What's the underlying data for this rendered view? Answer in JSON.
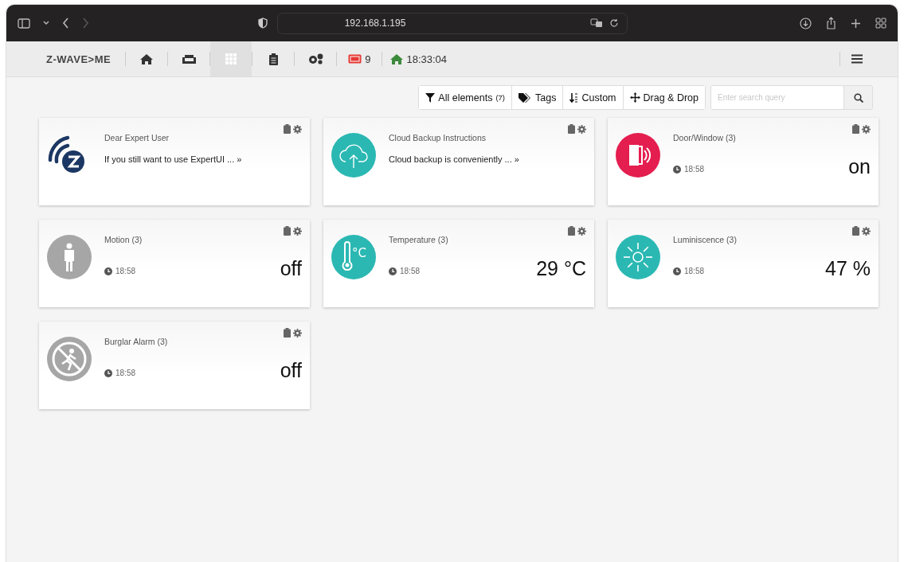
{
  "browser": {
    "url": "192.168.1.195"
  },
  "app_bar": {
    "logo": "Z-WAVE>ME",
    "nav": [
      {
        "selected": false
      },
      {
        "selected": false
      },
      {
        "selected": true
      },
      {
        "selected": false
      },
      {
        "selected": false
      }
    ],
    "events_count": "9",
    "time": "18:33:04"
  },
  "toolbar": {
    "filters": [
      {
        "label": "All elements",
        "count": "(7)"
      },
      {
        "label": "Tags"
      },
      {
        "label": "Custom"
      },
      {
        "label": "Drag & Drop"
      }
    ],
    "search": {
      "placeholder": "Enter search query"
    }
  },
  "cards": [
    {
      "kind": "message",
      "title": "Dear Expert User",
      "text": "If you still want to use ExpertUI ... »"
    },
    {
      "kind": "message",
      "title": "Cloud Backup Instructions",
      "text": "Cloud backup is conveniently ... »",
      "color": "#2bb8b3"
    },
    {
      "kind": "sensor",
      "title": "Door/Window (3)",
      "time": "18:58",
      "value": "on",
      "color": "#e41e4f"
    },
    {
      "kind": "sensor",
      "title": "Motion (3)",
      "time": "18:58",
      "value": "off",
      "color": "#a6a6a6"
    },
    {
      "kind": "sensor",
      "title": "Temperature (3)",
      "icon_label": "°C",
      "time": "18:58",
      "value": "29 °C",
      "color": "#2bb8b3"
    },
    {
      "kind": "sensor",
      "title": "Luminiscence (3)",
      "time": "18:58",
      "value": "47 %",
      "color": "#2bb8b3"
    },
    {
      "kind": "sensor",
      "title": "Burglar Alarm (3)",
      "time": "18:58",
      "value": "off",
      "color": "#a6a6a6"
    }
  ]
}
